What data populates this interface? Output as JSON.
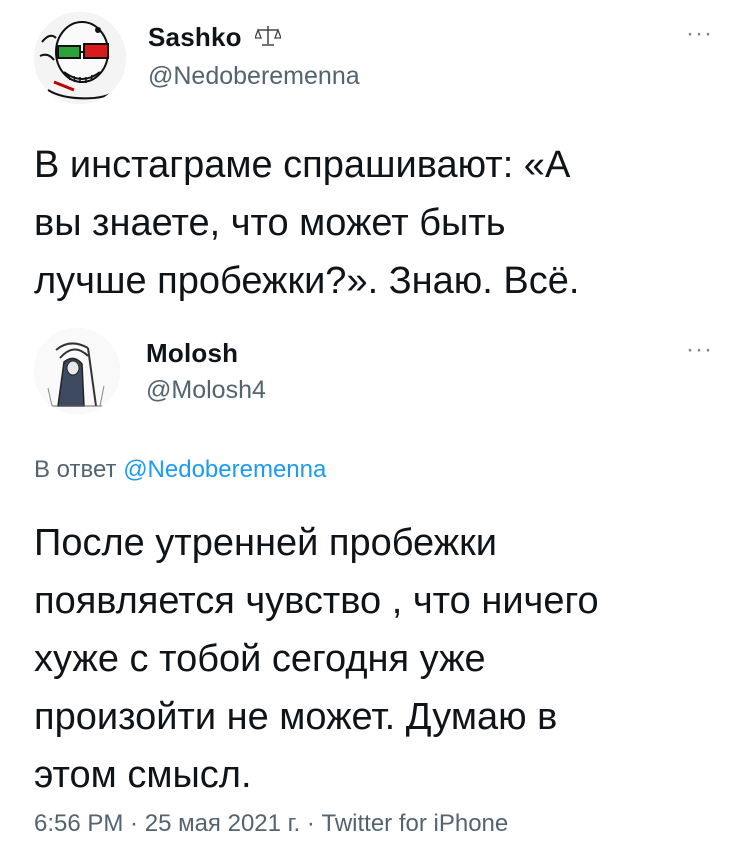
{
  "first_tweet": {
    "display_name": "Sashko",
    "badge_icon": "scales-icon",
    "handle": "@Nedoberemenna",
    "more_icon": "···",
    "text": "В инстаграме спрашивают: «А\nвы знаете, что может быть\nлучше пробежки?». Знаю. Всё."
  },
  "reply_tweet": {
    "display_name": "Molosh",
    "handle": "@Molosh4",
    "more_icon": "···",
    "reply_prefix": "В ответ",
    "reply_handle": "@Nedoberemenna",
    "text": "После утренней пробежки\nпоявляется чувство , что ничего\nхуже с тобой сегодня уже\nпроизойти не может. Думаю в\nэтом смысл.",
    "time": "6:56 PM",
    "separator": " · ",
    "date": "25 мая 2021 г.",
    "source": "Twitter for iPhone"
  },
  "colors": {
    "text": "#0f1419",
    "secondary": "#536471",
    "link": "#1d9bf0"
  }
}
